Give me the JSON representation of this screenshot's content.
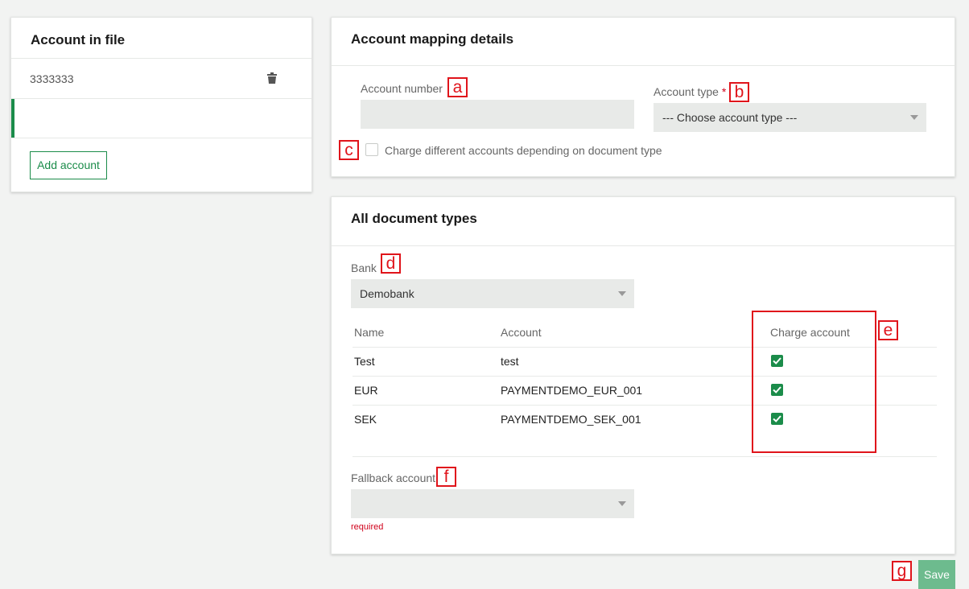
{
  "account_in_file": {
    "title": "Account in file",
    "accounts": [
      "3333333"
    ],
    "add_button": "Add account"
  },
  "mapping": {
    "title": "Account mapping details",
    "account_number_label": "Account number",
    "account_number_value": "",
    "account_type_label": "Account type",
    "required_mark": "*",
    "account_type_value": "--- Choose account type ---",
    "charge_different_label": "Charge different accounts depending on document type",
    "charge_different_checked": false
  },
  "doc_types": {
    "title": "All document types",
    "bank_label": "Bank",
    "bank_value": "Demobank",
    "columns": [
      "Name",
      "Account",
      "Charge account"
    ],
    "rows": [
      {
        "name": "Test",
        "account": "test",
        "charge": true
      },
      {
        "name": "EUR",
        "account": "PAYMENTDEMO_EUR_001",
        "charge": true
      },
      {
        "name": "SEK",
        "account": "PAYMENTDEMO_SEK_001",
        "charge": true
      }
    ],
    "fallback_label": "Fallback account",
    "fallback_value": "",
    "required_text": "required"
  },
  "save_label": "Save",
  "annotations": [
    "a",
    "b",
    "c",
    "d",
    "e",
    "f",
    "g"
  ],
  "colors": {
    "accent": "#1b8c4a",
    "save_button": "#6dbb8e",
    "annotation": "#e0141b",
    "required_text": "#d0021b"
  },
  "icons": {
    "delete": "trash-icon",
    "checkbox": "check-icon",
    "dropdown": "caret-down-icon"
  }
}
